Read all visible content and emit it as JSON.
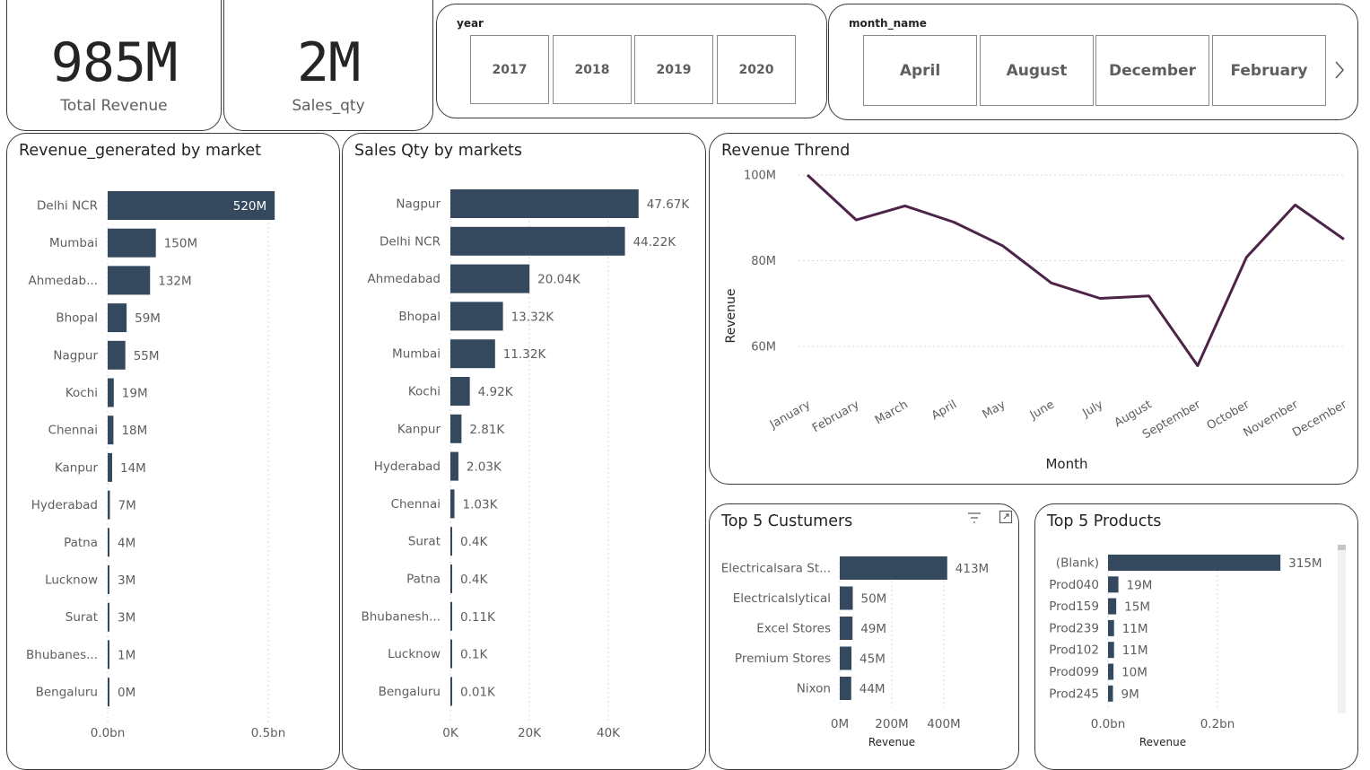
{
  "kpis": {
    "total_revenue": {
      "value": "985M",
      "label": "Total Revenue"
    },
    "sales_qty": {
      "value": "2M",
      "label": "Sales_qty"
    }
  },
  "year_slicer": {
    "title": "year",
    "options": [
      "2017",
      "2018",
      "2019",
      "2020"
    ]
  },
  "month_slicer": {
    "title": "month_name",
    "options": [
      "April",
      "August",
      "December",
      "February"
    ]
  },
  "colors": {
    "bar": "#34495e",
    "line": "#4d2448",
    "grid": "#d9d9d9"
  },
  "icons": {
    "filter": "filter-icon",
    "focus": "focus-mode-icon",
    "next": "chevron-right-icon"
  },
  "chart_data": [
    {
      "id": "revenue_by_market",
      "type": "bar",
      "orientation": "horizontal",
      "title": "Revenue_generated by market",
      "categories": [
        "Delhi NCR",
        "Mumbai",
        "Ahmedab...",
        "Bhopal",
        "Nagpur",
        "Kochi",
        "Chennai",
        "Kanpur",
        "Hyderabad",
        "Patna",
        "Lucknow",
        "Surat",
        "Bhubanes...",
        "Bengaluru"
      ],
      "values": [
        520,
        150,
        132,
        59,
        55,
        19,
        18,
        14,
        7,
        4,
        3,
        3,
        1,
        0
      ],
      "value_unit": "M",
      "data_labels": [
        "520M",
        "150M",
        "132M",
        "59M",
        "55M",
        "19M",
        "18M",
        "14M",
        "7M",
        "4M",
        "3M",
        "3M",
        "1M",
        "0M"
      ],
      "xlim": [
        0,
        500
      ],
      "x_ticks": [
        {
          "value": 0,
          "label": "0.0bn"
        },
        {
          "value": 500,
          "label": "0.5bn"
        }
      ],
      "grid": true
    },
    {
      "id": "sales_qty_by_market",
      "type": "bar",
      "orientation": "horizontal",
      "title": "Sales Qty by markets",
      "categories": [
        "Nagpur",
        "Delhi NCR",
        "Ahmedabad",
        "Bhopal",
        "Mumbai",
        "Kochi",
        "Kanpur",
        "Hyderabad",
        "Chennai",
        "Surat",
        "Patna",
        "Bhubanesh...",
        "Lucknow",
        "Bengaluru"
      ],
      "values": [
        47.67,
        44.22,
        20.04,
        13.32,
        11.32,
        4.92,
        2.81,
        2.03,
        1.03,
        0.4,
        0.4,
        0.11,
        0.1,
        0.01
      ],
      "value_unit": "K",
      "data_labels": [
        "47.67K",
        "44.22K",
        "20.04K",
        "13.32K",
        "11.32K",
        "4.92K",
        "2.81K",
        "2.03K",
        "1.03K",
        "0.4K",
        "0.4K",
        "0.11K",
        "0.1K",
        "0.01K"
      ],
      "xlim": [
        0,
        40
      ],
      "x_ticks": [
        {
          "value": 0,
          "label": "0K"
        },
        {
          "value": 20,
          "label": "20K"
        },
        {
          "value": 40,
          "label": "40K"
        }
      ],
      "grid": true
    },
    {
      "id": "revenue_trend",
      "type": "line",
      "title": "Revenue Thrend",
      "x": [
        "January",
        "February",
        "March",
        "April",
        "May",
        "June",
        "July",
        "August",
        "September",
        "October",
        "November",
        "December"
      ],
      "y": [
        100,
        89.5,
        92.8,
        89,
        83.5,
        74.8,
        71.2,
        71.8,
        55.5,
        80.8,
        93,
        85
      ],
      "xlabel": "Month",
      "ylabel": "Revenue",
      "ylim": [
        51,
        100
      ],
      "y_ticks": [
        {
          "value": 60,
          "label": "60M"
        },
        {
          "value": 80,
          "label": "80M"
        },
        {
          "value": 100,
          "label": "100M"
        }
      ],
      "grid": true
    },
    {
      "id": "top5_customers",
      "type": "bar",
      "orientation": "horizontal",
      "title": "Top 5 Custumers",
      "categories": [
        "Electricalsara St...",
        "Electricalslytical",
        "Excel Stores",
        "Premium Stores",
        "Nixon"
      ],
      "values": [
        413,
        50,
        49,
        45,
        44
      ],
      "value_unit": "M",
      "data_labels": [
        "413M",
        "50M",
        "49M",
        "45M",
        "44M"
      ],
      "xlim": [
        0,
        400
      ],
      "x_ticks": [
        {
          "value": 0,
          "label": "0M"
        },
        {
          "value": 200,
          "label": "200M"
        },
        {
          "value": 400,
          "label": "400M"
        }
      ],
      "xlabel": "Revenue",
      "grid": true
    },
    {
      "id": "top5_products",
      "type": "bar",
      "orientation": "horizontal",
      "title": "Top 5 Products",
      "categories": [
        "(Blank)",
        "Prod040",
        "Prod159",
        "Prod239",
        "Prod102",
        "Prod099",
        "Prod245"
      ],
      "values": [
        315,
        19,
        15,
        11,
        11,
        10,
        9
      ],
      "value_unit": "M",
      "data_labels": [
        "315M",
        "19M",
        "15M",
        "11M",
        "11M",
        "10M",
        "9M"
      ],
      "xlim": [
        0,
        200
      ],
      "x_ticks": [
        {
          "value": 0,
          "label": "0.0bn"
        },
        {
          "value": 200,
          "label": "0.2bn"
        }
      ],
      "xlabel": "Revenue",
      "grid": true
    }
  ]
}
